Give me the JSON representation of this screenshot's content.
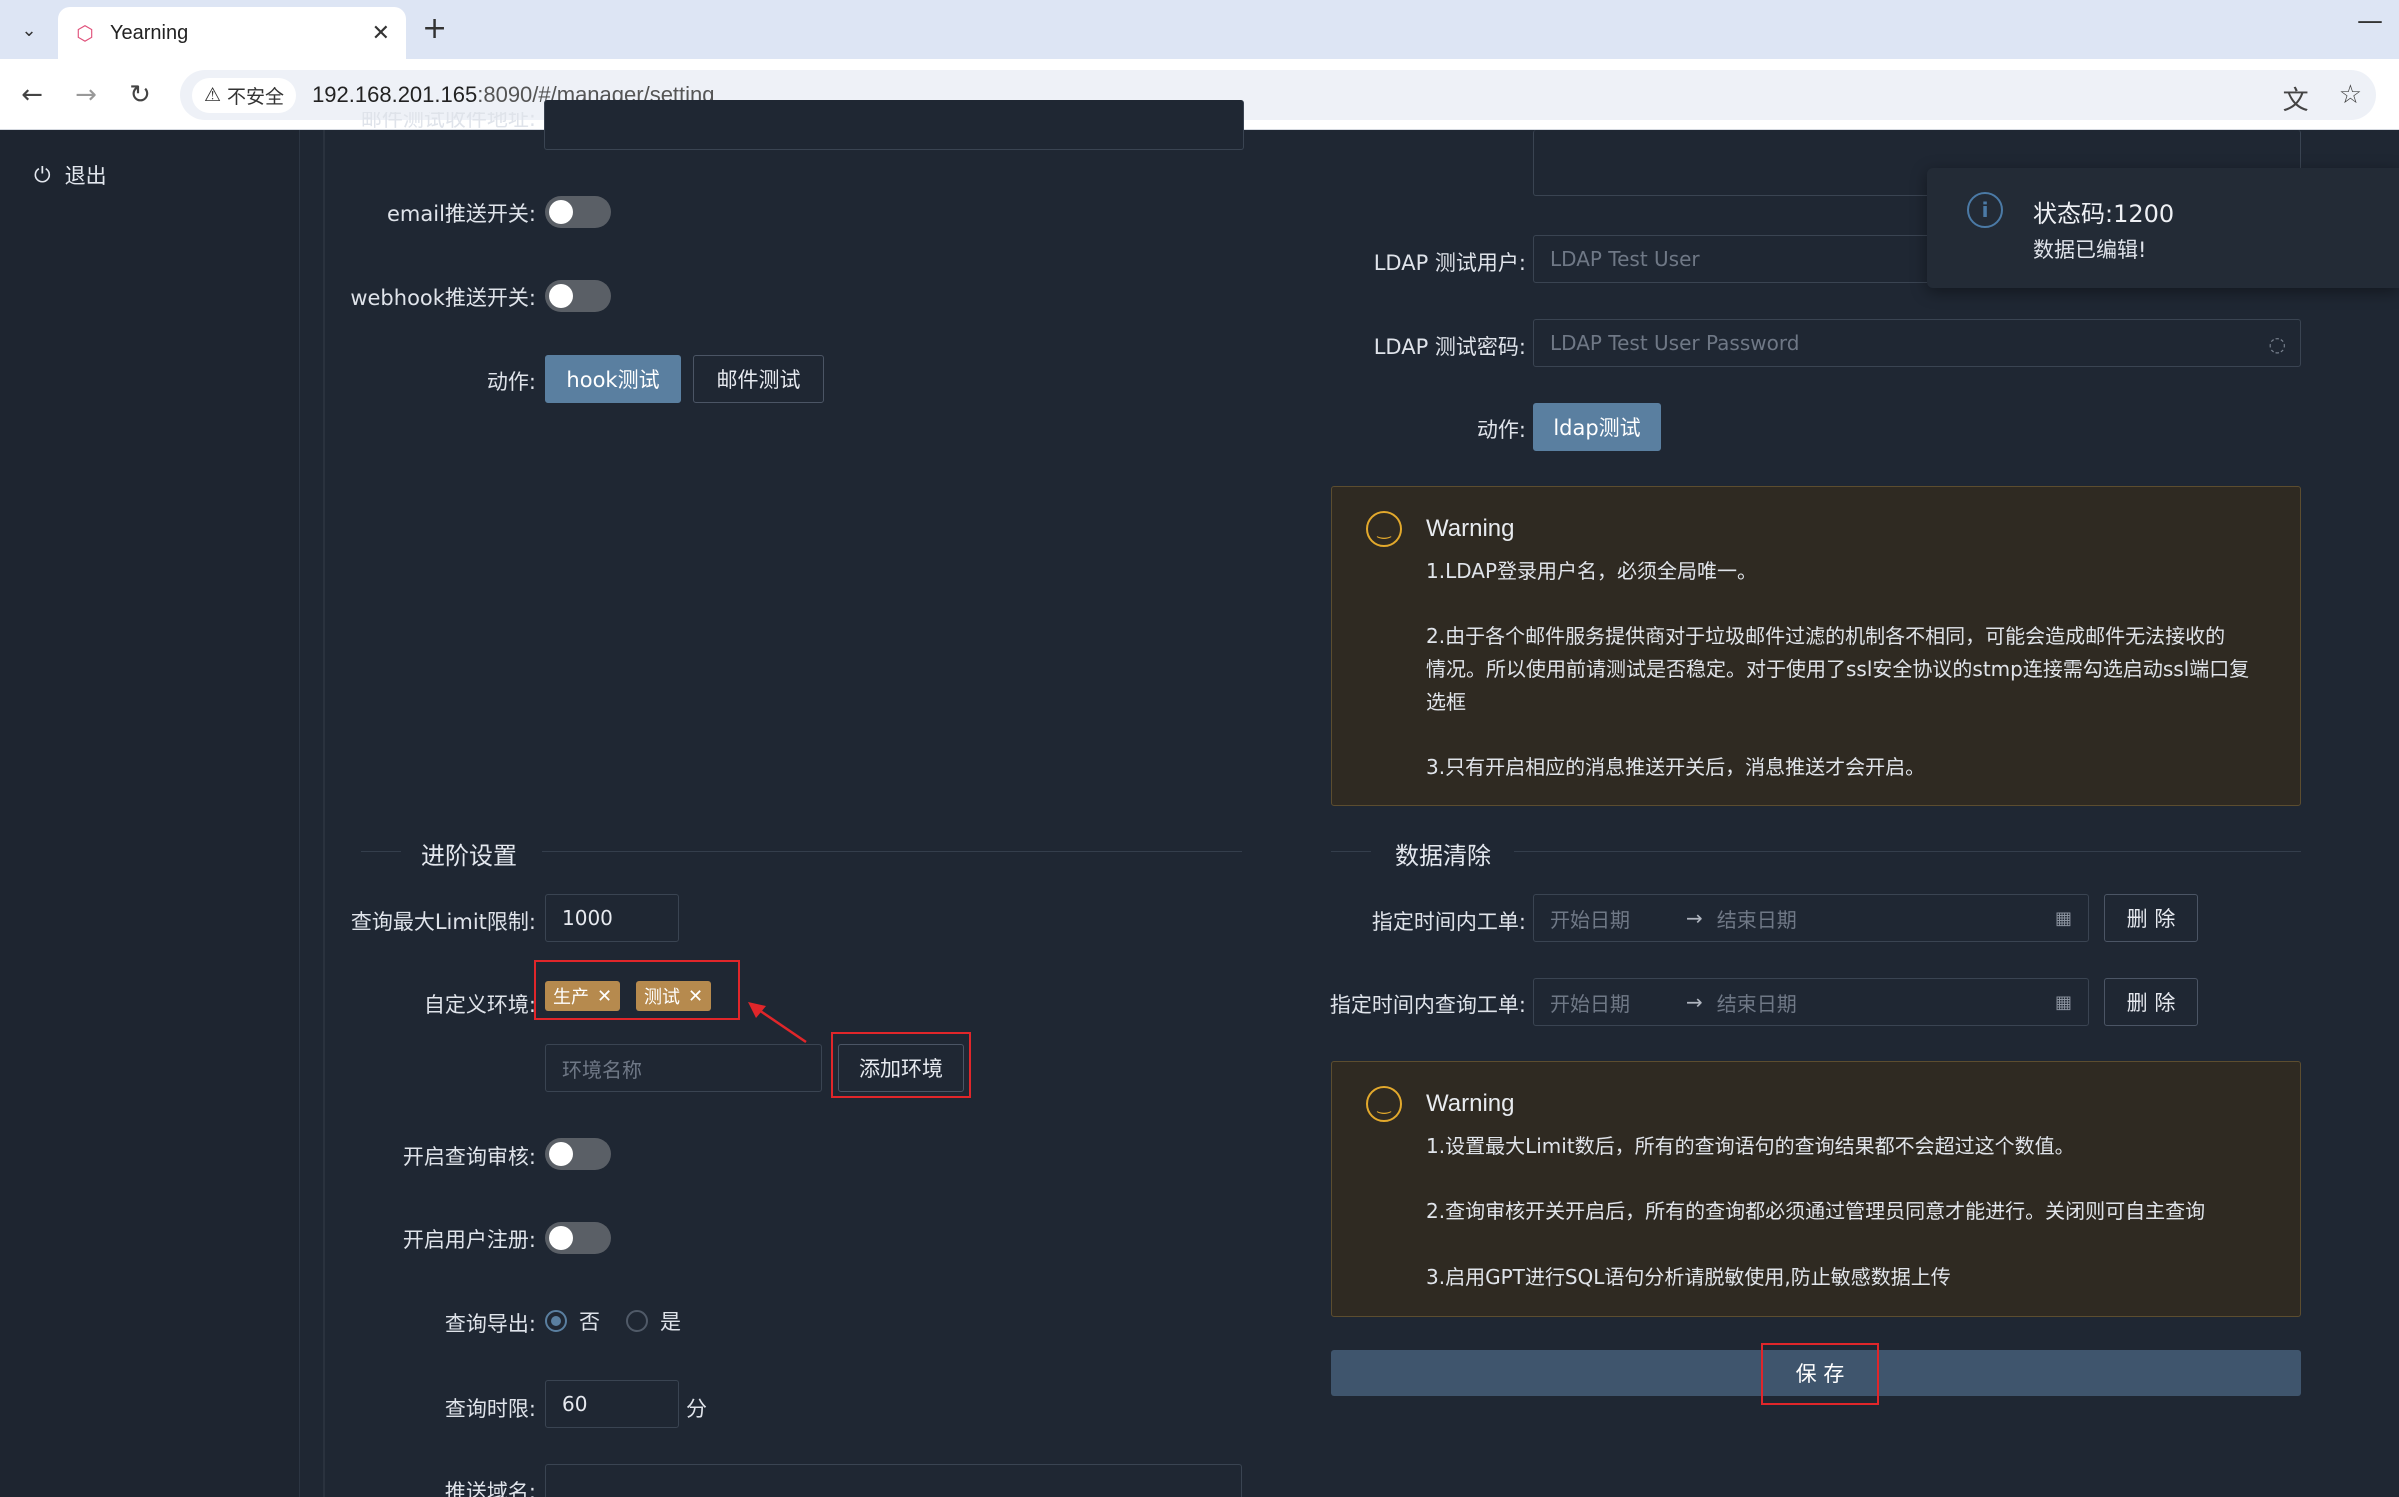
{
  "browser": {
    "tab_title": "Yearning",
    "insecure_label": "不安全",
    "url_host": "192.168.201.165",
    "url_rest": ":8090/#/manager/setting"
  },
  "sidebar": {
    "logout_label": "退出"
  },
  "left": {
    "mail_label_partial": "邮件测试收件地址:",
    "email_switch_label": "email推送开关:",
    "webhook_switch_label": "webhook推送开关:",
    "action_label": "动作:",
    "hook_test_button": "hook测试",
    "mail_test_button": "邮件测试",
    "advanced_title": "进阶设置",
    "limit_label": "查询最大Limit限制:",
    "limit_value": "1000",
    "custom_env_label": "自定义环境:",
    "env_tags": [
      "生产",
      "测试"
    ],
    "env_name_placeholder": "环境名称",
    "add_env_button": "添加环境",
    "query_audit_label": "开启查询审核:",
    "user_register_label": "开启用户注册:",
    "query_export_label": "查询导出:",
    "export_no": "否",
    "export_yes": "是",
    "query_timeout_label": "查询时限:",
    "query_timeout_value": "60",
    "query_timeout_unit": "分",
    "push_domain_label": "推送域名:"
  },
  "right": {
    "ldap_user_label": "LDAP 测试用户:",
    "ldap_user_placeholder": "LDAP Test User",
    "ldap_pwd_label": "LDAP 测试密码:",
    "ldap_pwd_placeholder": "LDAP Test User Password",
    "action_label": "动作:",
    "ldap_test_button": "ldap测试",
    "warning1": {
      "title": "Warning",
      "line1": "1.LDAP登录用户名，必须全局唯一。",
      "line2a": "2.由于各个邮件服务提供商对于垃圾邮件过滤的机制各不相同，可能会造成邮件无法接收的",
      "line2b": "情况。所以使用前请测试是否稳定。对于使用了ssl安全协议的stmp连接需勾选启动ssl端口复",
      "line2c": "选框",
      "line3": "3.只有开启相应的消息推送开关后，消息推送才会开启。"
    },
    "data_clean_title": "数据清除",
    "order_range_label": "指定时间内工单:",
    "query_range_label": "指定时间内查询工单:",
    "start_date_placeholder": "开始日期",
    "end_date_placeholder": "结束日期",
    "delete_button": "删 除",
    "warning2": {
      "title": "Warning",
      "line1": "1.设置最大Limit数后，所有的查询语句的查询结果都不会超过这个数值。",
      "line2": "2.查询审核开关开启后，所有的查询都必须通过管理员同意才能进行。关闭则可自主查询",
      "line3": "3.启用GPT进行SQL语句分析请脱敏使用,防止敏感数据上传"
    },
    "save_button": "保 存"
  },
  "notice": {
    "title": "状态码:1200",
    "desc": "数据已编辑!"
  },
  "colors": {
    "primary": "#5a7fa0",
    "tag": "#b68a4e",
    "warning_icon": "#e3a92c",
    "highlight": "#e0262a"
  }
}
